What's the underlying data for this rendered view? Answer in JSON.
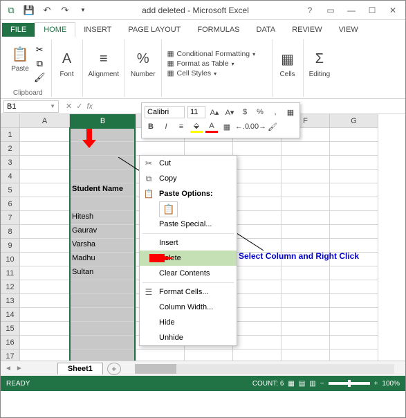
{
  "titlebar": {
    "title": "add deleted - Microsoft Excel"
  },
  "tabs": {
    "file": "FILE",
    "home": "HOME",
    "insert": "INSERT",
    "page_layout": "PAGE LAYOUT",
    "formulas": "FORMULAS",
    "data": "DATA",
    "review": "REVIEW",
    "view": "VIEW"
  },
  "ribbon": {
    "paste": "Paste",
    "clipboard": "Clipboard",
    "font": "Font",
    "alignment": "Alignment",
    "number": "Number",
    "cond_fmt": "Conditional Formatting",
    "fmt_table": "Format as Table",
    "cell_styles": "Cell Styles",
    "cells": "Cells",
    "editing": "Editing"
  },
  "namebox": "B1",
  "mini": {
    "font": "Calibri",
    "size": "11"
  },
  "columns": [
    "A",
    "B",
    "C",
    "D",
    "E",
    "F",
    "G"
  ],
  "rows": 17,
  "cells_b": {
    "5": "Student Name",
    "7": "Hitesh",
    "8": "Gaurav",
    "9": "Varsha",
    "10": "Madhu",
    "11": "Sultan"
  },
  "ctx": {
    "cut": "Cut",
    "copy": "Copy",
    "paste_opts": "Paste Options:",
    "paste_special": "Paste Special...",
    "insert": "Insert",
    "delete": "Delete",
    "clear": "Clear Contents",
    "format_cells": "Format Cells...",
    "col_width": "Column Width...",
    "hide": "Hide",
    "unhide": "Unhide"
  },
  "sheet": "Sheet1",
  "status": {
    "ready": "READY",
    "count": "COUNT: 6",
    "zoom": "100%"
  },
  "annot": "Select Column and Right Click"
}
